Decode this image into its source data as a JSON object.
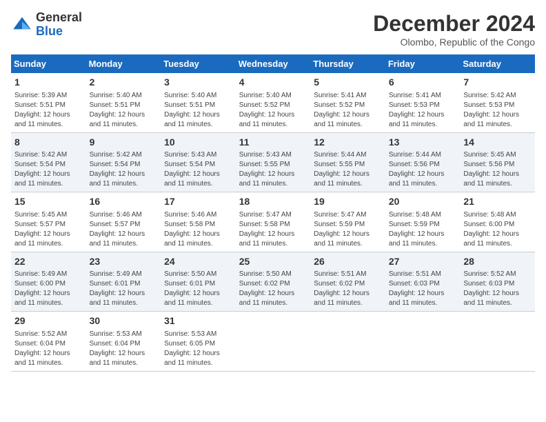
{
  "header": {
    "logo": {
      "general": "General",
      "blue": "Blue"
    },
    "title": "December 2024",
    "location": "Olombo, Republic of the Congo"
  },
  "columns": [
    "Sunday",
    "Monday",
    "Tuesday",
    "Wednesday",
    "Thursday",
    "Friday",
    "Saturday"
  ],
  "weeks": [
    [
      {
        "day": "1",
        "sunrise": "5:39 AM",
        "sunset": "5:51 PM",
        "daylight": "Daylight: 12 hours and 11 minutes."
      },
      {
        "day": "2",
        "sunrise": "5:40 AM",
        "sunset": "5:51 PM",
        "daylight": "Daylight: 12 hours and 11 minutes."
      },
      {
        "day": "3",
        "sunrise": "5:40 AM",
        "sunset": "5:51 PM",
        "daylight": "Daylight: 12 hours and 11 minutes."
      },
      {
        "day": "4",
        "sunrise": "5:40 AM",
        "sunset": "5:52 PM",
        "daylight": "Daylight: 12 hours and 11 minutes."
      },
      {
        "day": "5",
        "sunrise": "5:41 AM",
        "sunset": "5:52 PM",
        "daylight": "Daylight: 12 hours and 11 minutes."
      },
      {
        "day": "6",
        "sunrise": "5:41 AM",
        "sunset": "5:53 PM",
        "daylight": "Daylight: 12 hours and 11 minutes."
      },
      {
        "day": "7",
        "sunrise": "5:42 AM",
        "sunset": "5:53 PM",
        "daylight": "Daylight: 12 hours and 11 minutes."
      }
    ],
    [
      {
        "day": "8",
        "sunrise": "5:42 AM",
        "sunset": "5:54 PM",
        "daylight": "Daylight: 12 hours and 11 minutes."
      },
      {
        "day": "9",
        "sunrise": "5:42 AM",
        "sunset": "5:54 PM",
        "daylight": "Daylight: 12 hours and 11 minutes."
      },
      {
        "day": "10",
        "sunrise": "5:43 AM",
        "sunset": "5:54 PM",
        "daylight": "Daylight: 12 hours and 11 minutes."
      },
      {
        "day": "11",
        "sunrise": "5:43 AM",
        "sunset": "5:55 PM",
        "daylight": "Daylight: 12 hours and 11 minutes."
      },
      {
        "day": "12",
        "sunrise": "5:44 AM",
        "sunset": "5:55 PM",
        "daylight": "Daylight: 12 hours and 11 minutes."
      },
      {
        "day": "13",
        "sunrise": "5:44 AM",
        "sunset": "5:56 PM",
        "daylight": "Daylight: 12 hours and 11 minutes."
      },
      {
        "day": "14",
        "sunrise": "5:45 AM",
        "sunset": "5:56 PM",
        "daylight": "Daylight: 12 hours and 11 minutes."
      }
    ],
    [
      {
        "day": "15",
        "sunrise": "5:45 AM",
        "sunset": "5:57 PM",
        "daylight": "Daylight: 12 hours and 11 minutes."
      },
      {
        "day": "16",
        "sunrise": "5:46 AM",
        "sunset": "5:57 PM",
        "daylight": "Daylight: 12 hours and 11 minutes."
      },
      {
        "day": "17",
        "sunrise": "5:46 AM",
        "sunset": "5:58 PM",
        "daylight": "Daylight: 12 hours and 11 minutes."
      },
      {
        "day": "18",
        "sunrise": "5:47 AM",
        "sunset": "5:58 PM",
        "daylight": "Daylight: 12 hours and 11 minutes."
      },
      {
        "day": "19",
        "sunrise": "5:47 AM",
        "sunset": "5:59 PM",
        "daylight": "Daylight: 12 hours and 11 minutes."
      },
      {
        "day": "20",
        "sunrise": "5:48 AM",
        "sunset": "5:59 PM",
        "daylight": "Daylight: 12 hours and 11 minutes."
      },
      {
        "day": "21",
        "sunrise": "5:48 AM",
        "sunset": "6:00 PM",
        "daylight": "Daylight: 12 hours and 11 minutes."
      }
    ],
    [
      {
        "day": "22",
        "sunrise": "5:49 AM",
        "sunset": "6:00 PM",
        "daylight": "Daylight: 12 hours and 11 minutes."
      },
      {
        "day": "23",
        "sunrise": "5:49 AM",
        "sunset": "6:01 PM",
        "daylight": "Daylight: 12 hours and 11 minutes."
      },
      {
        "day": "24",
        "sunrise": "5:50 AM",
        "sunset": "6:01 PM",
        "daylight": "Daylight: 12 hours and 11 minutes."
      },
      {
        "day": "25",
        "sunrise": "5:50 AM",
        "sunset": "6:02 PM",
        "daylight": "Daylight: 12 hours and 11 minutes."
      },
      {
        "day": "26",
        "sunrise": "5:51 AM",
        "sunset": "6:02 PM",
        "daylight": "Daylight: 12 hours and 11 minutes."
      },
      {
        "day": "27",
        "sunrise": "5:51 AM",
        "sunset": "6:03 PM",
        "daylight": "Daylight: 12 hours and 11 minutes."
      },
      {
        "day": "28",
        "sunrise": "5:52 AM",
        "sunset": "6:03 PM",
        "daylight": "Daylight: 12 hours and 11 minutes."
      }
    ],
    [
      {
        "day": "29",
        "sunrise": "5:52 AM",
        "sunset": "6:04 PM",
        "daylight": "Daylight: 12 hours and 11 minutes."
      },
      {
        "day": "30",
        "sunrise": "5:53 AM",
        "sunset": "6:04 PM",
        "daylight": "Daylight: 12 hours and 11 minutes."
      },
      {
        "day": "31",
        "sunrise": "5:53 AM",
        "sunset": "6:05 PM",
        "daylight": "Daylight: 12 hours and 11 minutes."
      },
      null,
      null,
      null,
      null
    ]
  ]
}
